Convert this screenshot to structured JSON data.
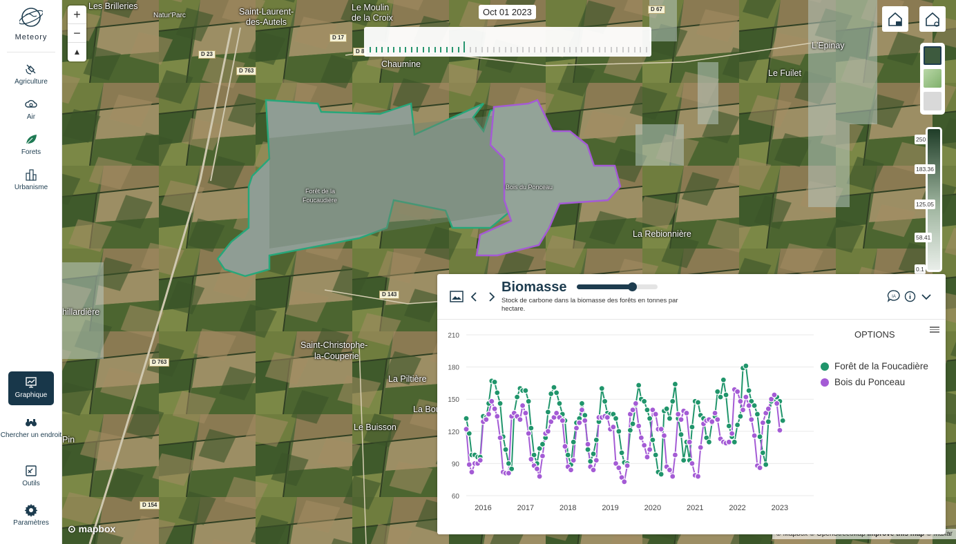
{
  "sidebar": {
    "brand": "Meteory",
    "items": [
      {
        "label": "Agriculture",
        "icon": "satellite-icon"
      },
      {
        "label": "Air",
        "icon": "cloud-icon"
      },
      {
        "label": "Forets",
        "icon": "leaf-icon"
      },
      {
        "label": "Urbanisme",
        "icon": "buildings-icon"
      },
      {
        "label": "Graphique",
        "icon": "chart-icon"
      },
      {
        "label": "Chercher un endroit",
        "icon": "binoculars-icon"
      },
      {
        "label": "Outils",
        "icon": "tools-icon"
      },
      {
        "label": "Paramètres",
        "icon": "gear-icon"
      }
    ]
  },
  "map": {
    "date": "Oct 01 2023",
    "places": [
      "Les Brilleries",
      "Natur'Parc",
      "Saint-Laurent-",
      "des-Autels",
      "Le Moulin",
      "de la Croix",
      "Chaumine",
      "L'Epinay",
      "Le Fuilet",
      "La Rebionnière",
      "Forêt de la",
      "Foucaudière",
      "Bois du Ponceau",
      "Saint-Christophe-",
      "la-Couperie",
      "La Piltière",
      "La Bourin",
      "Le Buisson",
      "hillardière",
      "Pin"
    ],
    "roads": [
      "D 17",
      "D 23",
      "D 763",
      "D 67",
      "D 143",
      "D 763",
      "D 154",
      "D 8"
    ],
    "legend": {
      "values": [
        "250",
        "183.36",
        "125.05",
        "58.41",
        "0.1"
      ]
    },
    "mapbox": "mapbox",
    "attribution": {
      "mapbox": "© Mapbox",
      "osm": "© OpenStreetMap",
      "improve": "Improve this map",
      "maxar": "© Maxar"
    }
  },
  "panel": {
    "title": "Biomasse",
    "subtitle": "Stock de carbone dans la biomasse des forêts en tonnes par hectare.",
    "options": "OPTIONS",
    "slider_value": 0.68
  },
  "chart_data": {
    "type": "line",
    "y_ticks": [
      "210",
      "180",
      "150",
      "120",
      "90",
      "60"
    ],
    "ylim": [
      60,
      210
    ],
    "x_ticks": [
      "2016",
      "2017",
      "2018",
      "2019",
      "2020",
      "2021",
      "2022",
      "2023"
    ],
    "xlim": [
      2015.6,
      2023.8
    ],
    "colors": {
      "green": "#20956b",
      "purple": "#a45bd5"
    },
    "series": [
      {
        "name": "Forêt de la Foucadière",
        "points": [
          [
            2015.6,
            132
          ],
          [
            2015.67,
            118
          ],
          [
            2015.73,
            98
          ],
          [
            2015.8,
            98
          ],
          [
            2015.87,
            96
          ],
          [
            2015.93,
            96
          ],
          [
            2016.0,
            134
          ],
          [
            2016.07,
            133
          ],
          [
            2016.13,
            146
          ],
          [
            2016.2,
            167
          ],
          [
            2016.27,
            166
          ],
          [
            2016.33,
            156
          ],
          [
            2016.4,
            146
          ],
          [
            2016.47,
            115
          ],
          [
            2016.53,
            103
          ],
          [
            2016.6,
            90
          ],
          [
            2016.67,
            85
          ],
          [
            2016.73,
            137
          ],
          [
            2016.8,
            152
          ],
          [
            2016.87,
            160
          ],
          [
            2016.93,
            158
          ],
          [
            2017.0,
            158
          ],
          [
            2017.07,
            148
          ],
          [
            2017.13,
            123
          ],
          [
            2017.2,
            98
          ],
          [
            2017.27,
            90
          ],
          [
            2017.33,
            104
          ],
          [
            2017.4,
            108
          ],
          [
            2017.47,
            114
          ],
          [
            2017.53,
            138
          ],
          [
            2017.6,
            155
          ],
          [
            2017.67,
            161
          ],
          [
            2017.73,
            156
          ],
          [
            2017.8,
            146
          ],
          [
            2017.87,
            136
          ],
          [
            2017.93,
            130
          ],
          [
            2018.0,
            98
          ],
          [
            2018.07,
            89
          ],
          [
            2018.13,
            110
          ],
          [
            2018.2,
            128
          ],
          [
            2018.27,
            132
          ],
          [
            2018.33,
            146
          ],
          [
            2018.4,
            135
          ],
          [
            2018.47,
            103
          ],
          [
            2018.53,
            92
          ],
          [
            2018.6,
            99
          ],
          [
            2018.67,
            112
          ],
          [
            2018.73,
            129
          ],
          [
            2018.8,
            160
          ],
          [
            2018.87,
            148
          ],
          [
            2018.93,
            137
          ],
          [
            2019.0,
            136
          ],
          [
            2019.07,
            136
          ],
          [
            2019.13,
            132
          ],
          [
            2019.2,
            120
          ],
          [
            2019.27,
            100
          ],
          [
            2019.33,
            91
          ],
          [
            2019.4,
            90
          ],
          [
            2019.47,
            121
          ],
          [
            2019.53,
            127
          ],
          [
            2019.6,
            145
          ],
          [
            2019.67,
            163
          ],
          [
            2019.73,
            150
          ],
          [
            2019.8,
            148
          ],
          [
            2019.87,
            140
          ],
          [
            2019.93,
            132
          ],
          [
            2020.0,
            112
          ],
          [
            2020.07,
            98
          ],
          [
            2020.13,
            82
          ],
          [
            2020.2,
            80
          ],
          [
            2020.27,
            139
          ],
          [
            2020.33,
            141
          ],
          [
            2020.4,
            132
          ],
          [
            2020.47,
            148
          ],
          [
            2020.53,
            164
          ],
          [
            2020.6,
            132
          ],
          [
            2020.67,
            117
          ],
          [
            2020.73,
            93
          ],
          [
            2020.8,
            110
          ],
          [
            2020.87,
            93
          ],
          [
            2020.93,
            124
          ],
          [
            2021.0,
            148
          ],
          [
            2021.07,
            147
          ],
          [
            2021.13,
            135
          ],
          [
            2021.2,
            132
          ],
          [
            2021.27,
            114
          ],
          [
            2021.33,
            110
          ],
          [
            2021.4,
            128
          ],
          [
            2021.47,
            134
          ],
          [
            2021.53,
            157
          ],
          [
            2021.6,
            152
          ],
          [
            2021.67,
            168
          ],
          [
            2021.73,
            154
          ],
          [
            2021.8,
            125
          ],
          [
            2021.87,
            115
          ],
          [
            2021.93,
            110
          ],
          [
            2022.0,
            126
          ],
          [
            2022.07,
            134
          ],
          [
            2022.13,
            179
          ],
          [
            2022.2,
            181
          ],
          [
            2022.27,
            158
          ],
          [
            2022.33,
            148
          ],
          [
            2022.4,
            144
          ],
          [
            2022.47,
            136
          ],
          [
            2022.53,
            115
          ],
          [
            2022.6,
            100
          ],
          [
            2022.67,
            89
          ],
          [
            2022.73,
            129
          ],
          [
            2022.8,
            148
          ],
          [
            2022.87,
            150
          ],
          [
            2022.93,
            152
          ],
          [
            2023.0,
            148
          ],
          [
            2023.07,
            130
          ]
        ]
      },
      {
        "name": "Bois du Ponceau",
        "points": [
          [
            2015.6,
            122
          ],
          [
            2015.67,
            89
          ],
          [
            2015.73,
            82
          ],
          [
            2015.8,
            90
          ],
          [
            2015.87,
            90
          ],
          [
            2015.93,
            93
          ],
          [
            2016.0,
            129
          ],
          [
            2016.07,
            131
          ],
          [
            2016.13,
            136
          ],
          [
            2016.2,
            148
          ],
          [
            2016.27,
            141
          ],
          [
            2016.33,
            134
          ],
          [
            2016.4,
            114
          ],
          [
            2016.47,
            82
          ],
          [
            2016.53,
            81
          ],
          [
            2016.6,
            81
          ],
          [
            2016.67,
            134
          ],
          [
            2016.73,
            137
          ],
          [
            2016.8,
            134
          ],
          [
            2016.87,
            131
          ],
          [
            2016.93,
            144
          ],
          [
            2017.0,
            137
          ],
          [
            2017.07,
            118
          ],
          [
            2017.13,
            94
          ],
          [
            2017.2,
            88
          ],
          [
            2017.27,
            85
          ],
          [
            2017.33,
            78
          ],
          [
            2017.4,
            97
          ],
          [
            2017.47,
            118
          ],
          [
            2017.53,
            120
          ],
          [
            2017.6,
            129
          ],
          [
            2017.67,
            133
          ],
          [
            2017.73,
            137
          ],
          [
            2017.8,
            133
          ],
          [
            2017.87,
            130
          ],
          [
            2017.93,
            106
          ],
          [
            2018.0,
            87
          ],
          [
            2018.07,
            84
          ],
          [
            2018.13,
            93
          ],
          [
            2018.2,
            123
          ],
          [
            2018.27,
            128
          ],
          [
            2018.33,
            140
          ],
          [
            2018.4,
            130
          ],
          [
            2018.47,
            108
          ],
          [
            2018.53,
            87
          ],
          [
            2018.6,
            84
          ],
          [
            2018.67,
            93
          ],
          [
            2018.73,
            133
          ],
          [
            2018.8,
            133
          ],
          [
            2018.87,
            134
          ],
          [
            2018.93,
            133
          ],
          [
            2019.0,
            122
          ],
          [
            2019.07,
            124
          ],
          [
            2019.13,
            90
          ],
          [
            2019.2,
            86
          ],
          [
            2019.27,
            77
          ],
          [
            2019.33,
            73
          ],
          [
            2019.4,
            88
          ],
          [
            2019.47,
            136
          ],
          [
            2019.53,
            140
          ],
          [
            2019.6,
            146
          ],
          [
            2019.67,
            125
          ],
          [
            2019.73,
            114
          ],
          [
            2019.8,
            107
          ],
          [
            2019.87,
            96
          ],
          [
            2019.93,
            103
          ],
          [
            2020.0,
            140
          ],
          [
            2020.07,
            136
          ],
          [
            2020.13,
            122
          ],
          [
            2020.2,
            122
          ],
          [
            2020.27,
            116
          ],
          [
            2020.33,
            87
          ],
          [
            2020.4,
            84
          ],
          [
            2020.47,
            78
          ],
          [
            2020.53,
            98
          ],
          [
            2020.6,
            136
          ],
          [
            2020.67,
            131
          ],
          [
            2020.73,
            139
          ],
          [
            2020.8,
            137
          ],
          [
            2020.87,
            110
          ],
          [
            2020.93,
            90
          ],
          [
            2021.0,
            79
          ],
          [
            2021.07,
            78
          ],
          [
            2021.13,
            105
          ],
          [
            2021.2,
            127
          ],
          [
            2021.27,
            130
          ],
          [
            2021.33,
            131
          ],
          [
            2021.4,
            129
          ],
          [
            2021.47,
            137
          ],
          [
            2021.53,
            131
          ],
          [
            2021.6,
            113
          ],
          [
            2021.67,
            110
          ],
          [
            2021.73,
            109
          ],
          [
            2021.8,
            110
          ],
          [
            2021.87,
            118
          ],
          [
            2021.93,
            159
          ],
          [
            2022.0,
            157
          ],
          [
            2022.07,
            148
          ],
          [
            2022.13,
            140
          ],
          [
            2022.2,
            152
          ],
          [
            2022.27,
            144
          ],
          [
            2022.33,
            131
          ],
          [
            2022.4,
            116
          ],
          [
            2022.47,
            88
          ],
          [
            2022.53,
            86
          ],
          [
            2022.6,
            128
          ],
          [
            2022.67,
            137
          ],
          [
            2022.73,
            141
          ],
          [
            2022.8,
            150
          ],
          [
            2022.87,
            154
          ],
          [
            2022.93,
            146
          ],
          [
            2023.0,
            121
          ]
        ]
      }
    ]
  }
}
